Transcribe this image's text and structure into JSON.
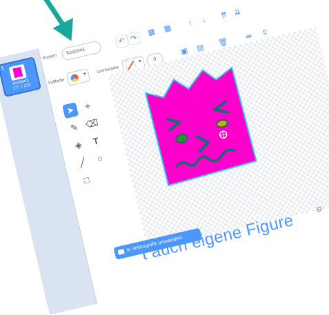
{
  "sidebar": {
    "costume": {
      "number": "1",
      "name": "Kostüm1",
      "size": "177 x 228"
    }
  },
  "toolbar": {
    "costume_label": "Kostüm",
    "costume_name": "Kostüm1",
    "fill_label": "Füllfarbe",
    "outline_label": "Umrissfarbe",
    "outline_width": "0"
  },
  "icons": [
    "undo-icon",
    "redo-icon",
    "group-icon",
    "ungroup-icon",
    "forward-icon",
    "backward-icon",
    "front-icon",
    "back-icon",
    "flip-horizontal-icon",
    "flip-vertical-icon",
    "copy-icon",
    "paste-icon",
    "delete-icon"
  ],
  "tools": [
    "select",
    "reshape",
    "brush",
    "eraser",
    "fill",
    "text",
    "line",
    "circle",
    "rectangle"
  ],
  "convert_button": "In Vektorgrafik umwandeln",
  "zoom": {
    "out": "⊖",
    "reset": "=",
    "in": "⊕"
  },
  "caption": "t auch eigene Figure",
  "colors": {
    "accent": "#4c97ff",
    "costume_fill": "#ff00cc",
    "costume_outline": "#36c5f0",
    "arrow": "#18a79a"
  }
}
